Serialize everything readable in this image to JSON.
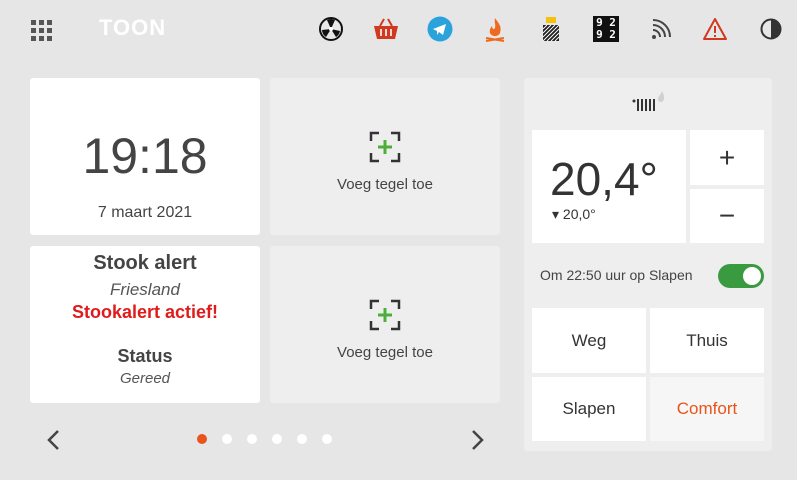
{
  "app": {
    "logo": "TOON"
  },
  "topbar": {
    "icons": [
      "fan-icon",
      "basket-icon",
      "telegram-icon",
      "flame-icon",
      "solar-panel-icon",
      "scoreboard-icon",
      "wifi-icon",
      "warning-icon",
      "contrast-icon"
    ],
    "scoreboard": {
      "top": "9 2",
      "bottom": "9 2"
    },
    "accent_orange": "#e8541a"
  },
  "clock": {
    "time": "19:18",
    "date": "7 maart 2021"
  },
  "tiles": {
    "add_label_1": "Voeg tegel toe",
    "add_label_2": "Voeg tegel toe"
  },
  "stook": {
    "title": "Stook alert",
    "region": "Friesland",
    "alert": "Stookalert actief!",
    "status_label": "Status",
    "status_value": "Gereed"
  },
  "pager": {
    "count": 6,
    "active": 0
  },
  "thermostat": {
    "current": "20,4°",
    "setpoint": "▾ 20,0°",
    "plus": "+",
    "minus": "−",
    "schedule": "Om 22:50 uur op Slapen",
    "toggle_on": true,
    "presets": [
      "Weg",
      "Thuis",
      "Slapen",
      "Comfort"
    ],
    "active_preset": "Comfort"
  },
  "colors": {
    "alert_red": "#e01b1b",
    "toggle_green": "#3a9a3f",
    "plus_green": "#4caf3a"
  }
}
